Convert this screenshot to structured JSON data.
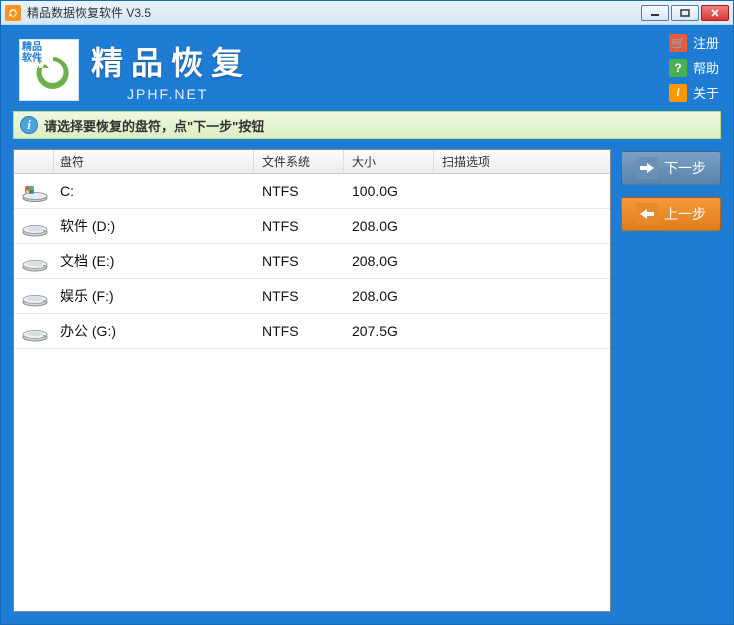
{
  "window": {
    "title": "精品数据恢复软件 V3.5"
  },
  "brand": {
    "logo_tag": "精品\n软件",
    "name": "精品恢复",
    "site": "JPHF.NET"
  },
  "top_links": {
    "register": "注册",
    "help": "帮助",
    "about": "关于"
  },
  "info": "请选择要恢复的盘符，点\"下一步\"按钮",
  "columns": {
    "drive": "盘符",
    "fs": "文件系统",
    "size": "大小",
    "options": "扫描选项"
  },
  "drives": [
    {
      "icon": "system",
      "label": "C:",
      "fs": "NTFS",
      "size": "100.0G",
      "options": ""
    },
    {
      "icon": "hdd",
      "label": "软件 (D:)",
      "fs": "NTFS",
      "size": "208.0G",
      "options": ""
    },
    {
      "icon": "hdd",
      "label": "文档 (E:)",
      "fs": "NTFS",
      "size": "208.0G",
      "options": ""
    },
    {
      "icon": "hdd",
      "label": "娱乐 (F:)",
      "fs": "NTFS",
      "size": "208.0G",
      "options": ""
    },
    {
      "icon": "hdd",
      "label": "办公 (G:)",
      "fs": "NTFS",
      "size": "207.5G",
      "options": ""
    }
  ],
  "nav": {
    "next": "下一步",
    "prev": "上一步"
  }
}
